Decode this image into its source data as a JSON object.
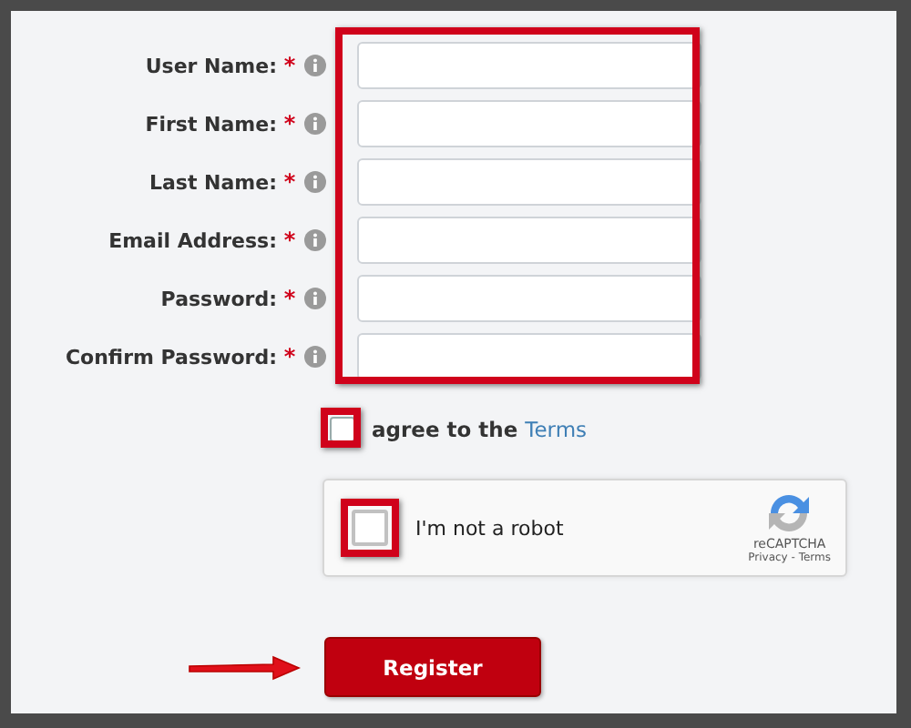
{
  "form": {
    "fields": [
      {
        "label": "User Name:",
        "required": true,
        "required_mark": "*"
      },
      {
        "label": "First Name:",
        "required": true,
        "required_mark": "*"
      },
      {
        "label": "Last Name:",
        "required": true,
        "required_mark": "*"
      },
      {
        "label": "Email Address:",
        "required": true,
        "required_mark": "*"
      },
      {
        "label": "Password:",
        "required": true,
        "required_mark": "*"
      },
      {
        "label": "Confirm Password:",
        "required": true,
        "required_mark": "*"
      }
    ],
    "terms": {
      "text": "agree to the",
      "link": "Terms",
      "checked": false
    },
    "captcha": {
      "label": "I'm not a robot",
      "checked": false,
      "brand": "reCAPTCHA",
      "links": "Privacy - Terms"
    },
    "submit": {
      "label": "Register"
    }
  }
}
